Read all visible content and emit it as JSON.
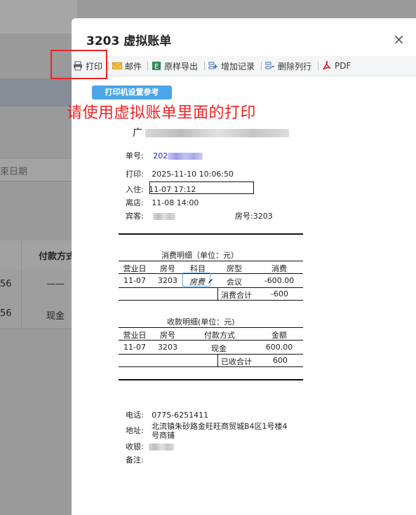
{
  "background": {
    "date_placeholder": "束日期",
    "col_header": "付款方式",
    "rows": [
      {
        "c1": "56",
        "c2": "——"
      },
      {
        "c1": "56",
        "c2": "现金"
      }
    ]
  },
  "modal": {
    "title": "3203 虚拟账单",
    "close": "×"
  },
  "toolbar": {
    "print": "打印",
    "mail": "邮件",
    "export": "原样导出",
    "add_record": "增加记录",
    "delete_column": "删除列行",
    "pdf": "PDF"
  },
  "printer_settings": "打印机设置参考",
  "annotation": "请使用虚拟账单里面的打印",
  "receipt": {
    "company_prefix": "广",
    "bill_no_label": "单号:",
    "bill_no_value": "202",
    "print_label": "打印:",
    "print_value": "2025-11-10 10:06:50",
    "checkin_label": "入住:",
    "checkin_value": "11-07 17:12",
    "checkout_label": "离店:",
    "checkout_value": "11-08 14:00",
    "guest_label": "宾客:",
    "guest_value": "",
    "room_label": "房号:3203",
    "consume_title": "消费明细（单位：元）",
    "consume_headers": [
      "营业日",
      "房号",
      "科目",
      "房型",
      "消费"
    ],
    "consume_row": [
      "11-07",
      "3203",
      "房费",
      "会议",
      "-600.00"
    ],
    "consume_total_label": "消费合计",
    "consume_total": "-600",
    "receive_title": "收款明细(单位：元)",
    "receive_headers": [
      "营业日",
      "房号",
      "付款方式",
      "金额"
    ],
    "receive_row": [
      "11-07",
      "3203",
      "现金",
      "600.00"
    ],
    "receive_total_label": "已收合计",
    "receive_total": "600",
    "phone_label": "电话:",
    "phone_value": "0775-6251411",
    "address_label": "地址:",
    "address_line1": "北流镇朱砂路金旺旺商贸城B4区1号楼4",
    "address_line2": "号商铺",
    "cashier_label": "收银:",
    "remark_label": "备注:"
  },
  "colors": {
    "accent": "#4aa6e8",
    "annotation": "#e22222",
    "link_blue": "#2222cc"
  }
}
